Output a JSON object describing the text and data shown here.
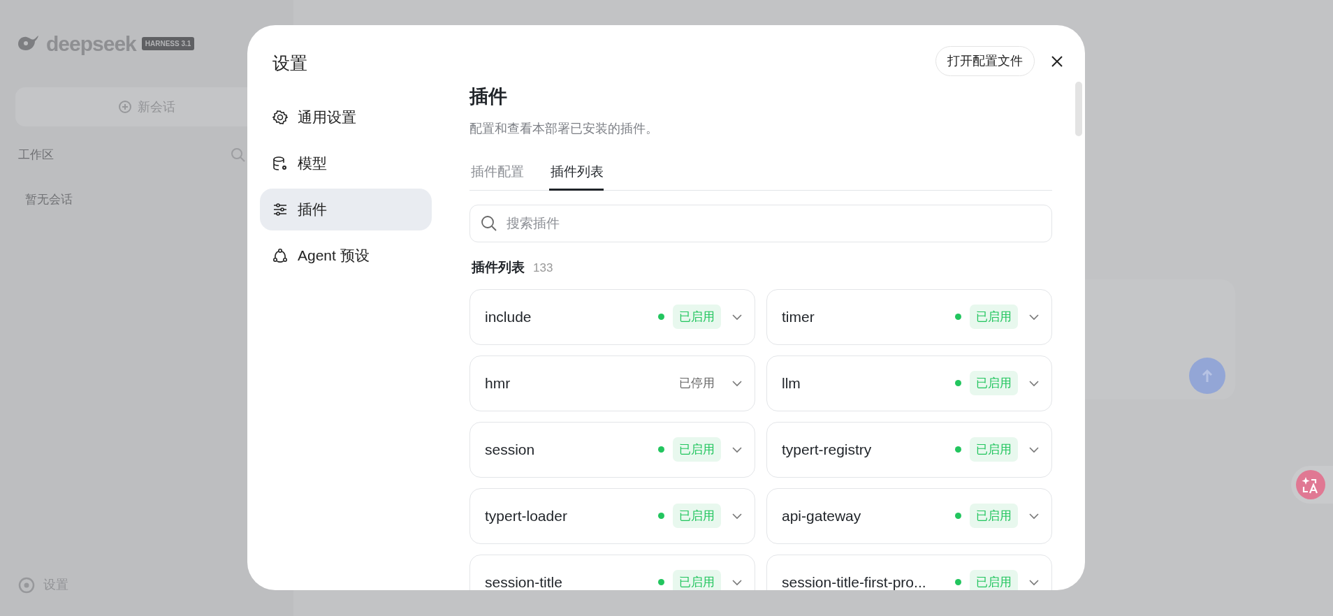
{
  "background": {
    "logo": "deepseek",
    "logo_badge": "HARNESS 3.1",
    "new_chat": "新会话",
    "workspace_label": "工作区",
    "empty_sessions": "暂无会话",
    "settings_link": "设置"
  },
  "dialog": {
    "title": "设置",
    "open_config_button": "打开配置文件",
    "nav": [
      {
        "label": "通用设置",
        "kind": "gear",
        "selected": false
      },
      {
        "label": "模型",
        "kind": "database",
        "selected": false
      },
      {
        "label": "插件",
        "kind": "sliders",
        "selected": true
      },
      {
        "label": "Agent 预设",
        "kind": "nodes",
        "selected": false
      }
    ],
    "heading": "插件",
    "description": "配置和查看本部署已安装的插件。",
    "tabs": [
      {
        "label": "插件配置",
        "selected": false
      },
      {
        "label": "插件列表",
        "selected": true
      }
    ],
    "search": {
      "placeholder": "搜索插件"
    },
    "list_title": "插件列表",
    "count": "133",
    "plugins": [
      {
        "name": "include",
        "enabled": true,
        "status": "已启用"
      },
      {
        "name": "timer",
        "enabled": true,
        "status": "已启用"
      },
      {
        "name": "hmr",
        "enabled": false,
        "status": "已停用"
      },
      {
        "name": "llm",
        "enabled": true,
        "status": "已启用"
      },
      {
        "name": "session",
        "enabled": true,
        "status": "已启用"
      },
      {
        "name": "typert-registry",
        "enabled": true,
        "status": "已启用"
      },
      {
        "name": "typert-loader",
        "enabled": true,
        "status": "已启用"
      },
      {
        "name": "api-gateway",
        "enabled": true,
        "status": "已启用"
      },
      {
        "name": "session-title",
        "enabled": true,
        "status": "已启用"
      },
      {
        "name": "session-title-first-pro...",
        "enabled": true,
        "status": "已启用"
      }
    ]
  }
}
